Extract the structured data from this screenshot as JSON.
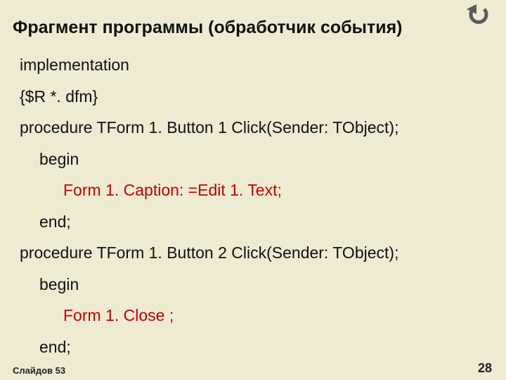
{
  "title": "Фрагмент программы (обработчик события)",
  "code": {
    "l1": "implementation",
    "l2": "{$R *. dfm}",
    "l3": "procedure TForm 1. Button 1 Click(Sender: TObject);",
    "l4": "begin",
    "l5": "Form 1. Caption: =Edit 1. Text;",
    "l6": "end;",
    "l7": "procedure TForm 1. Button 2 Click(Sender: TObject);",
    "l8": "begin",
    "l9": "Form 1. Close ;",
    "l10": "end;"
  },
  "footer": {
    "left": "Слайдов 53",
    "page": "28"
  }
}
